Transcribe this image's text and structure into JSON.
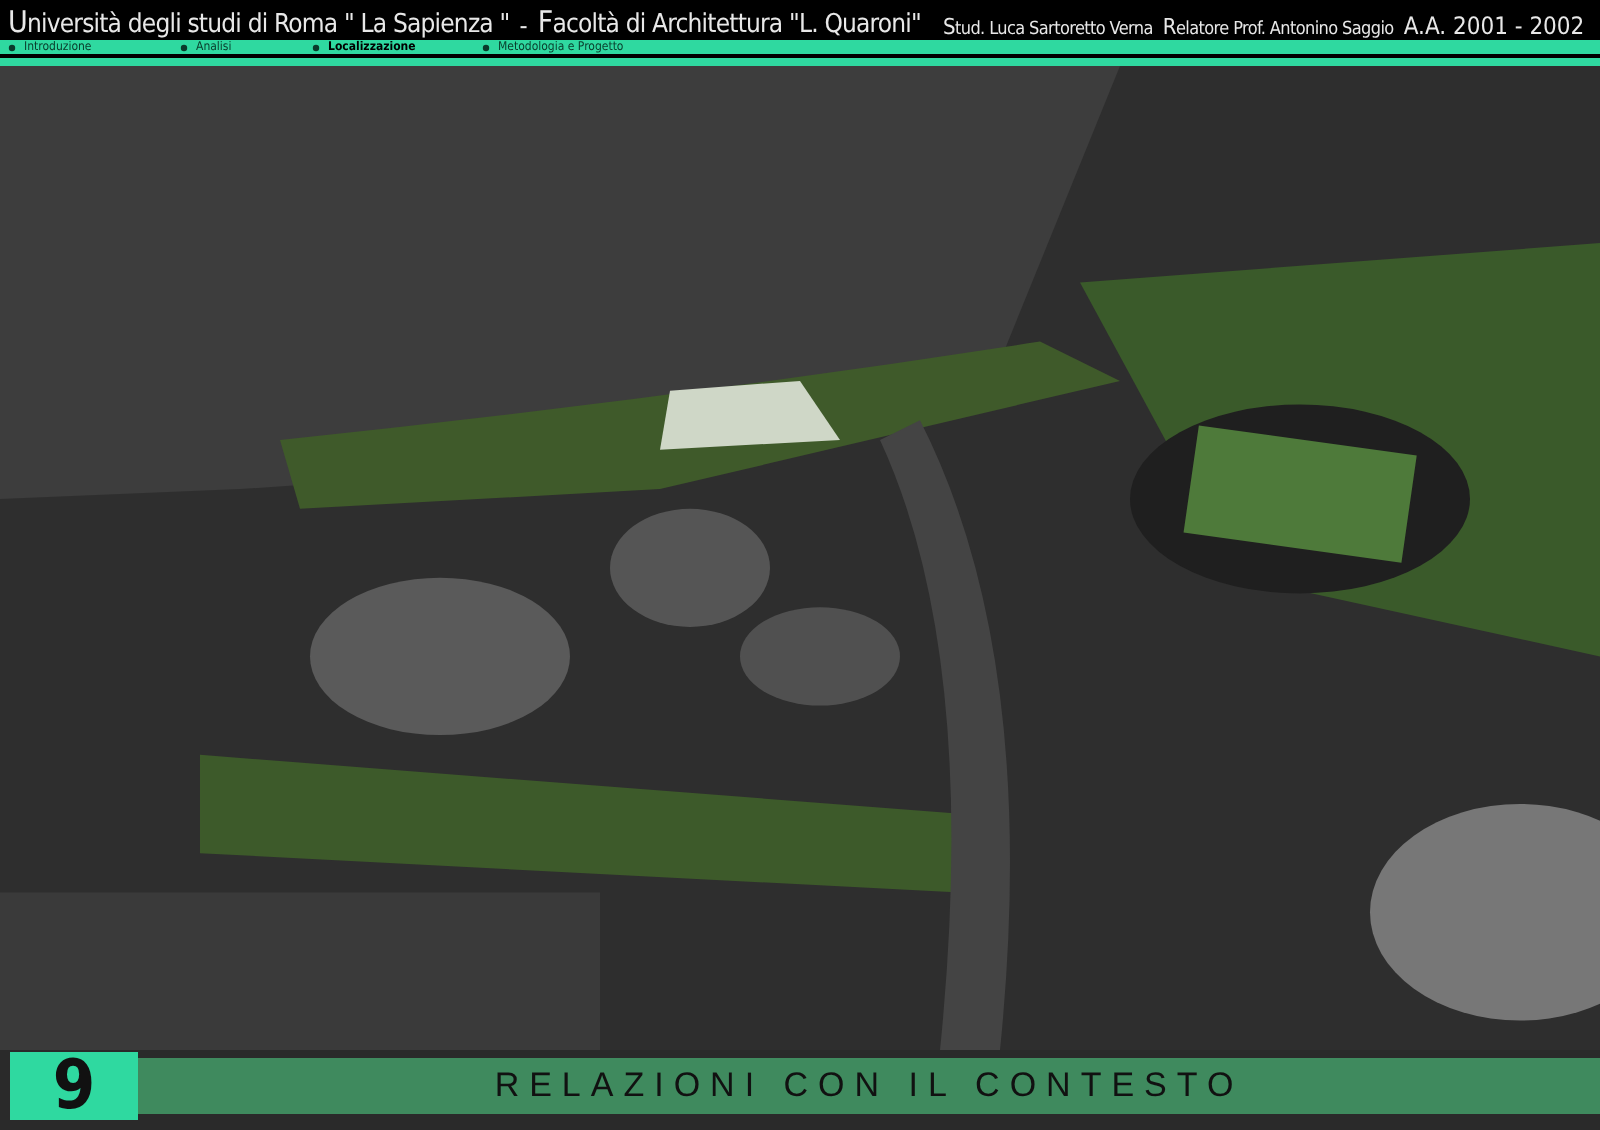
{
  "header": {
    "university": "**U**niversità degli studi di Roma \" La Sapienza \"",
    "separator": "-",
    "faculty": "**F**acoltà di Architettura \"L. Quaroni\"",
    "student": "**S**tud. Luca Sartoretto Verna",
    "supervisor": "**R**elatore Prof. Antonino Saggio",
    "year": "A.A. 2001 - 2002"
  },
  "nav": [
    {
      "label": "Introduzione",
      "selected": false
    },
    {
      "label": "Analisi",
      "selected": false
    },
    {
      "label": "Localizzazione",
      "selected": true
    },
    {
      "label": "Metodologia e Progetto",
      "selected": false
    }
  ],
  "footer": {
    "number": "9",
    "title": "RELAZIONI CON IL CONTESTO"
  }
}
